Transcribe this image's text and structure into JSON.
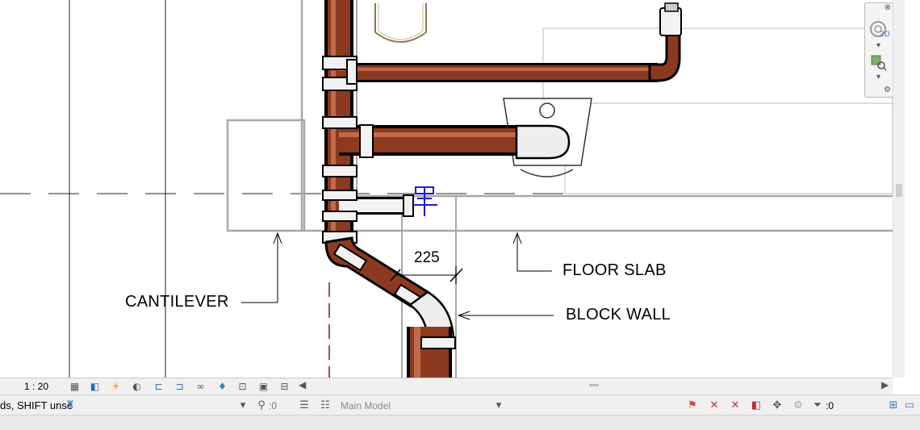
{
  "annotations": {
    "cantilever": "CANTILEVER",
    "floor_slab": "FLOOR SLAB",
    "block_wall": "BLOCK WALL",
    "dimension": "225"
  },
  "view_bar": {
    "scale": "1 : 20",
    "icons": [
      "detail-level-icon",
      "visual-style-icon",
      "sun-path-icon",
      "shadows-icon",
      "crop-view-icon",
      "crop-region-icon",
      "temporary-hide-icon",
      "reveal-hidden-icon",
      "analytical-model-icon",
      "highlight-displacement-icon",
      "reveal-constraints-icon"
    ]
  },
  "nav_bar": {
    "close": "⊗",
    "wheel_label": "2D"
  },
  "status_bar": {
    "text": "ds, SHIFT unse",
    "worksets_value": ":0",
    "model": "Main Model",
    "filter_value": ":0"
  }
}
